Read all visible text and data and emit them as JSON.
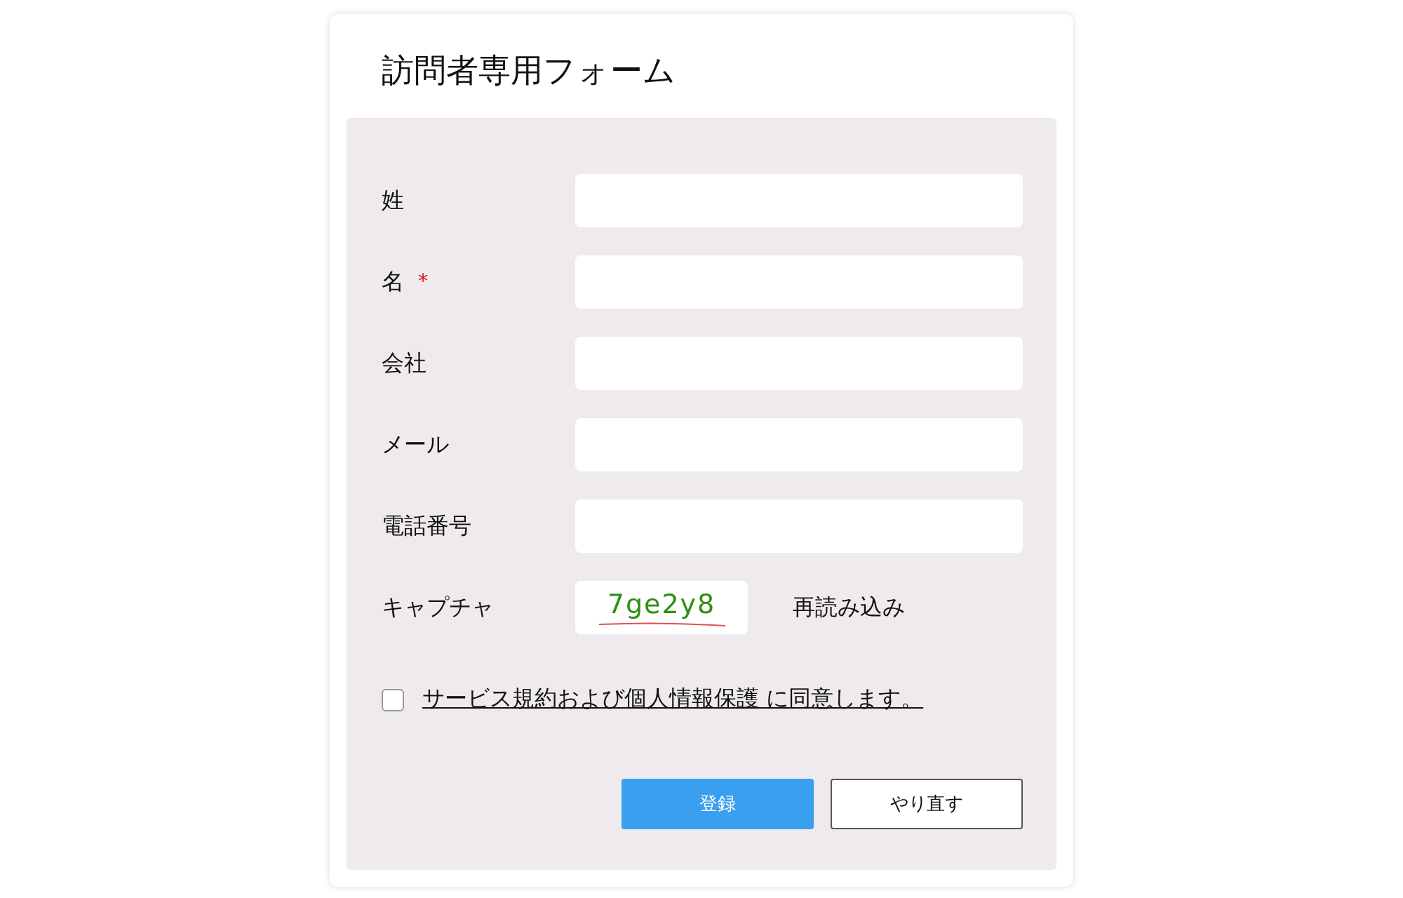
{
  "form": {
    "title": "訪問者専用フォーム",
    "fields": [
      {
        "label": "姓"
      },
      {
        "label": "名",
        "required_mark": "*"
      },
      {
        "label": "会社"
      },
      {
        "label": "メール"
      },
      {
        "label": "電話番号"
      }
    ],
    "captcha": {
      "label": "キャプチャ",
      "code": "7ge2y8",
      "reload": "再読み込み"
    },
    "agreement": {
      "checked": false,
      "text": "サービス規約および個人情報保護 に同意します。"
    },
    "buttons": [
      {
        "label": "登録",
        "kind": "primary"
      },
      {
        "label": "やり直す",
        "kind": "secondary"
      }
    ]
  }
}
